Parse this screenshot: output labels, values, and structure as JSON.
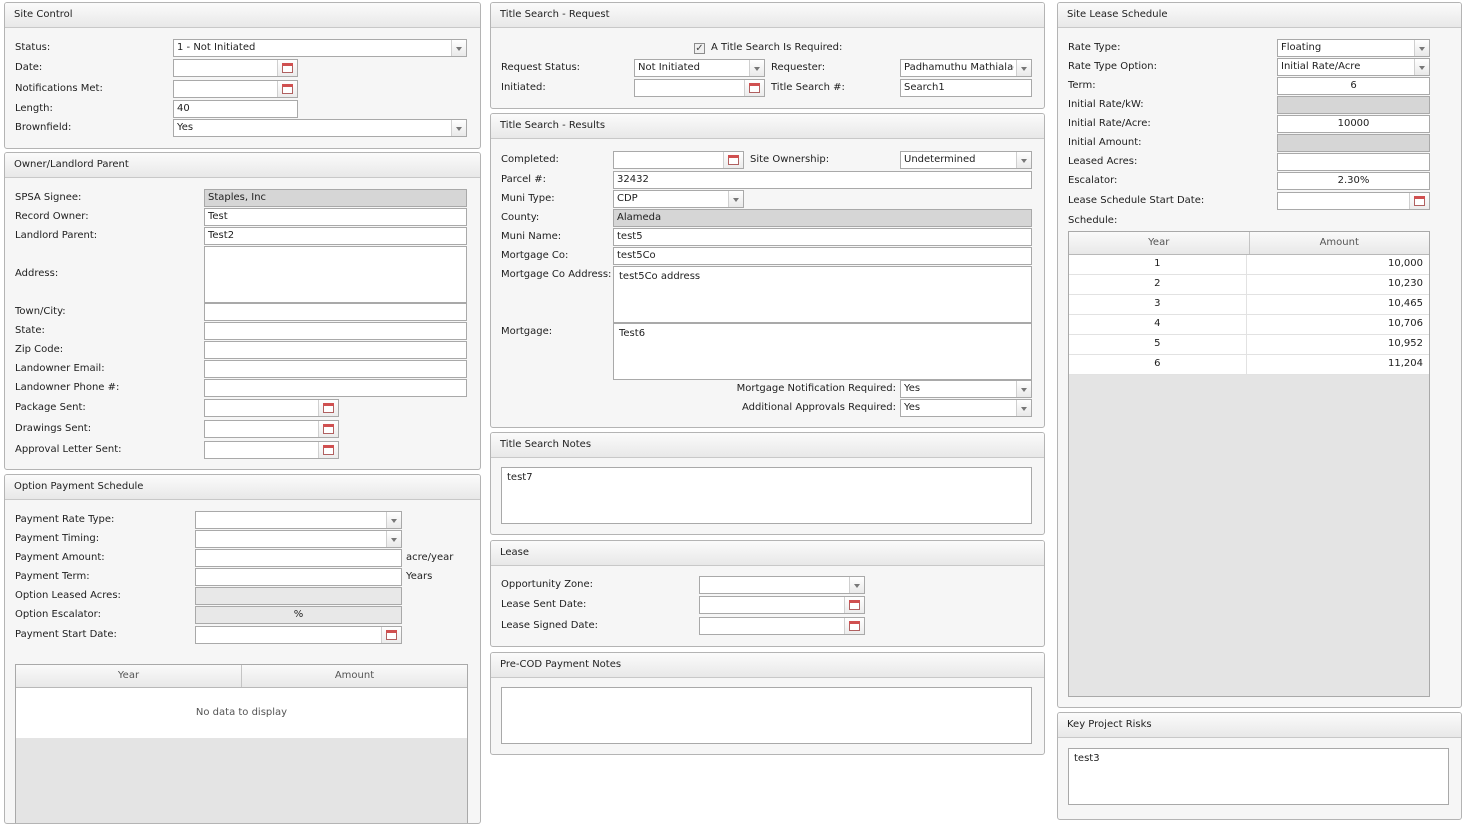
{
  "site_control": {
    "title": "Site Control",
    "status_label": "Status:",
    "status_value": "1 - Not Initiated",
    "date_label": "Date:",
    "notifications_label": "Notifications Met:",
    "length_label": "Length:",
    "length_value": "40",
    "brownfield_label": "Brownfield:",
    "brownfield_value": "Yes"
  },
  "owner": {
    "title": "Owner/Landlord Parent",
    "spsa_label": "SPSA Signee:",
    "spsa_value": "Staples, Inc",
    "record_owner_label": "Record Owner:",
    "record_owner_value": "Test",
    "landlord_parent_label": "Landlord Parent:",
    "landlord_parent_value": "Test2",
    "address_label": "Address:",
    "town_label": "Town/City:",
    "state_label": "State:",
    "zip_label": "Zip Code:",
    "email_label": "Landowner Email:",
    "phone_label": "Landowner Phone #:",
    "package_label": "Package Sent:",
    "drawings_label": "Drawings Sent:",
    "approval_label": "Approval Letter Sent:"
  },
  "option_payment": {
    "title": "Option Payment Schedule",
    "rate_type_label": "Payment Rate Type:",
    "timing_label": "Payment Timing:",
    "amount_label": "Payment Amount:",
    "amount_unit": "acre/year",
    "term_label": "Payment Term:",
    "term_unit": "Years",
    "leased_acres_label": "Option Leased Acres:",
    "escalator_label": "Option Escalator:",
    "escalator_value": "%",
    "start_date_label": "Payment Start Date:",
    "grid_col_year": "Year",
    "grid_col_amount": "Amount",
    "no_data": "No data to display"
  },
  "title_request": {
    "title": "Title Search - Request",
    "required_label": "A Title Search Is Required:",
    "required_checked": "✓",
    "request_status_label": "Request Status:",
    "request_status_value": "Not Initiated",
    "requester_label": "Requester:",
    "requester_value": "Padhamuthu Mathialagan",
    "initiated_label": "Initiated:",
    "title_search_no_label": "Title Search #:",
    "title_search_no_value": "Search1"
  },
  "title_results": {
    "title": "Title Search - Results",
    "completed_label": "Completed:",
    "site_ownership_label": "Site Ownership:",
    "site_ownership_value": "Undetermined",
    "parcel_label": "Parcel #:",
    "parcel_value": "32432",
    "muni_type_label": "Muni Type:",
    "muni_type_value": "CDP",
    "county_label": "County:",
    "county_value": "Alameda",
    "muni_name_label": "Muni Name:",
    "muni_name_value": "test5",
    "mortgage_co_label": "Mortgage Co:",
    "mortgage_co_value": "test5Co",
    "mortgage_co_address_label": "Mortgage Co Address:",
    "mortgage_co_address_value": "test5Co address",
    "mortgage_label": "Mortgage:",
    "mortgage_value": "Test6",
    "mortgage_notif_label": "Mortgage Notification Required:",
    "mortgage_notif_value": "Yes",
    "additional_approvals_label": "Additional Approvals Required:",
    "additional_approvals_value": "Yes"
  },
  "title_notes": {
    "title": "Title Search Notes",
    "value": "test7"
  },
  "lease": {
    "title": "Lease",
    "opportunity_zone_label": "Opportunity Zone:",
    "lease_sent_label": "Lease Sent Date:",
    "lease_signed_label": "Lease Signed Date:"
  },
  "precod": {
    "title": "Pre-COD Payment Notes",
    "value": ""
  },
  "site_lease": {
    "title": "Site Lease Schedule",
    "rate_type_label": "Rate Type:",
    "rate_type_value": "Floating",
    "rate_type_option_label": "Rate Type Option:",
    "rate_type_option_value": "Initial Rate/Acre",
    "term_label": "Term:",
    "term_value": "6",
    "initial_rate_kw_label": "Initial Rate/kW:",
    "initial_rate_acre_label": "Initial Rate/Acre:",
    "initial_rate_acre_value": "10000",
    "initial_amount_label": "Initial Amount:",
    "leased_acres_label": "Leased Acres:",
    "escalator_label": "Escalator:",
    "escalator_value": "2.30%",
    "start_date_label": "Lease Schedule Start Date:",
    "schedule_label": "Schedule:",
    "col_year": "Year",
    "col_amount": "Amount",
    "rows": [
      {
        "year": "1",
        "amount": "10,000"
      },
      {
        "year": "2",
        "amount": "10,230"
      },
      {
        "year": "3",
        "amount": "10,465"
      },
      {
        "year": "4",
        "amount": "10,706"
      },
      {
        "year": "5",
        "amount": "10,952"
      },
      {
        "year": "6",
        "amount": "11,204"
      }
    ]
  },
  "key_risks": {
    "title": "Key Project Risks",
    "value": "test3"
  }
}
